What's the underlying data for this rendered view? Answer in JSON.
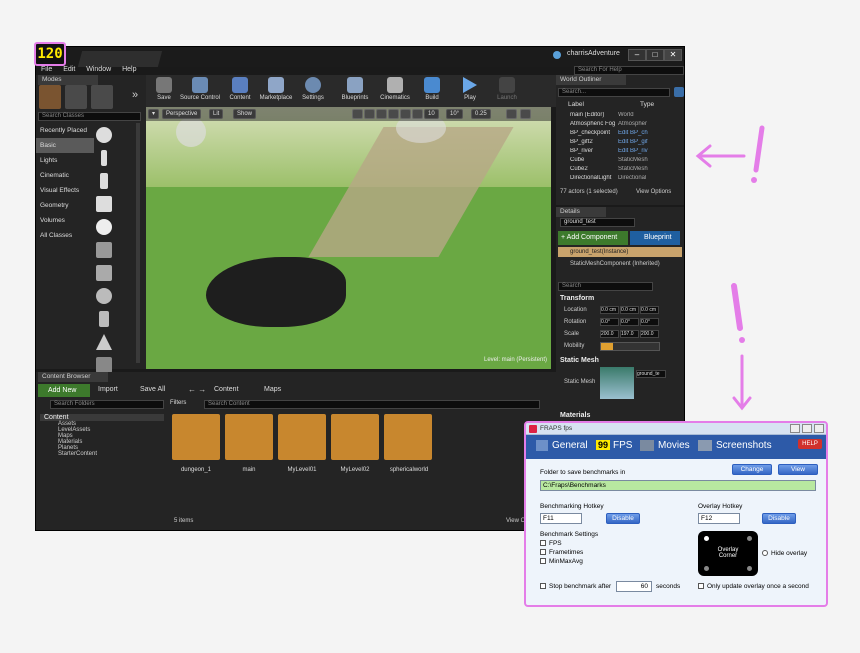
{
  "fps_counter": "120",
  "editor": {
    "window_title": "charrisAdventure",
    "menu": [
      "File",
      "Edit",
      "Window",
      "Help"
    ],
    "search_help_placeholder": "Search For Help",
    "modes": {
      "tab": "Modes",
      "search_placeholder": "Search Classes",
      "categories": [
        "Recently Placed",
        "Basic",
        "Lights",
        "Cinematic",
        "Visual Effects",
        "Geometry",
        "Volumes",
        "All Classes"
      ],
      "selected": "Basic"
    },
    "toolbar": [
      "Save",
      "Source Control",
      "Content",
      "Marketplace",
      "Settings",
      "Blueprints",
      "Cinematics",
      "Build",
      "Play",
      "Launch"
    ],
    "viewport": {
      "perspective": "Perspective",
      "lit": "Lit",
      "show": "Show",
      "grid_snap": "10",
      "rot_snap": "10°",
      "scale_snap": "0.25",
      "level_label": "Level:  main (Persistent)"
    },
    "outliner": {
      "tab": "World Outliner",
      "search_placeholder": "Search...",
      "col_label": "Label",
      "col_type": "Type",
      "rows": [
        {
          "label": "main (Editor)",
          "type": "World"
        },
        {
          "label": "Atmospheric Fog",
          "type": "Atmospher"
        },
        {
          "label": "BP_checkpoint",
          "type": "Edit BP_ch"
        },
        {
          "label": "BP_gift2",
          "type": "Edit BP_gif"
        },
        {
          "label": "BP_river",
          "type": "Edit BP_riv"
        },
        {
          "label": "Cube",
          "type": "StaticMesh"
        },
        {
          "label": "Cube2",
          "type": "StaticMesh"
        },
        {
          "label": "DirectionalLight",
          "type": "Directional"
        }
      ],
      "footer": "77 actors (1 selected)",
      "view_options": "View Options"
    },
    "details": {
      "tab": "Details",
      "name": "ground_test",
      "add_component": "+ Add Component",
      "blueprint": "Blueprint",
      "components": [
        "ground_test(Instance)",
        "StaticMeshComponent (Inherited)"
      ],
      "search_placeholder": "Search",
      "transform": "Transform",
      "location_label": "Location",
      "location": [
        "0.0 cm",
        "0.0 cm",
        "0.0 cm"
      ],
      "rotation_label": "Rotation",
      "rotation": [
        "0.0°",
        "0.0°",
        "0.0°"
      ],
      "scale_label": "Scale",
      "scale": [
        "200.0",
        "197.0",
        "200.0"
      ],
      "mobility_label": "Mobility",
      "static_mesh_section": "Static Mesh",
      "static_mesh_label": "Static Mesh",
      "static_mesh_value": "ground_te",
      "materials_section": "Materials"
    },
    "content_browser": {
      "tab": "Content Browser",
      "add_new": "Add New",
      "import": "Import",
      "save_all": "Save All",
      "path": [
        "Content",
        "Maps"
      ],
      "search_folders_placeholder": "Search Folders",
      "filters": "Filters",
      "search_content_placeholder": "Search Content",
      "tree": [
        "Content",
        "Assets",
        "LevelAssets",
        "Maps",
        "Materials",
        "Planets",
        "StarterContent"
      ],
      "assets": [
        "dungeon_1",
        "main",
        "MyLevel01",
        "MyLevel02",
        "sphericalworld"
      ],
      "item_count": "5 items",
      "view_options": "View Op"
    }
  },
  "fraps": {
    "title": "FRAPS fps",
    "tabs": [
      "General",
      "FPS",
      "Movies",
      "Screenshots"
    ],
    "fps_tab_number": "99",
    "help": "HELP",
    "folder_label": "Folder to save benchmarks in",
    "change": "Change",
    "view": "View",
    "folder_value": "C:\\Fraps\\Benchmarks",
    "bench_hotkey_label": "Benchmarking Hotkey",
    "bench_hotkey_value": "F11",
    "overlay_hotkey_label": "Overlay Hotkey",
    "overlay_hotkey_value": "F12",
    "disable": "Disable",
    "bench_settings_label": "Benchmark Settings",
    "bench_options": [
      "FPS",
      "Frametimes",
      "MinMaxAvg"
    ],
    "overlay_corner": "Overlay Corner",
    "hide_overlay": "Hide overlay",
    "stop_after_label": "Stop benchmark after",
    "stop_after_value": "60",
    "seconds": "seconds",
    "only_update": "Only update overlay once a second"
  },
  "colors": {
    "annotation": "#e47de8",
    "fps_yellow": "#ffea00",
    "ue_bg": "#242424",
    "folder_orange": "#c8872e",
    "fraps_blue": "#3567c5"
  }
}
